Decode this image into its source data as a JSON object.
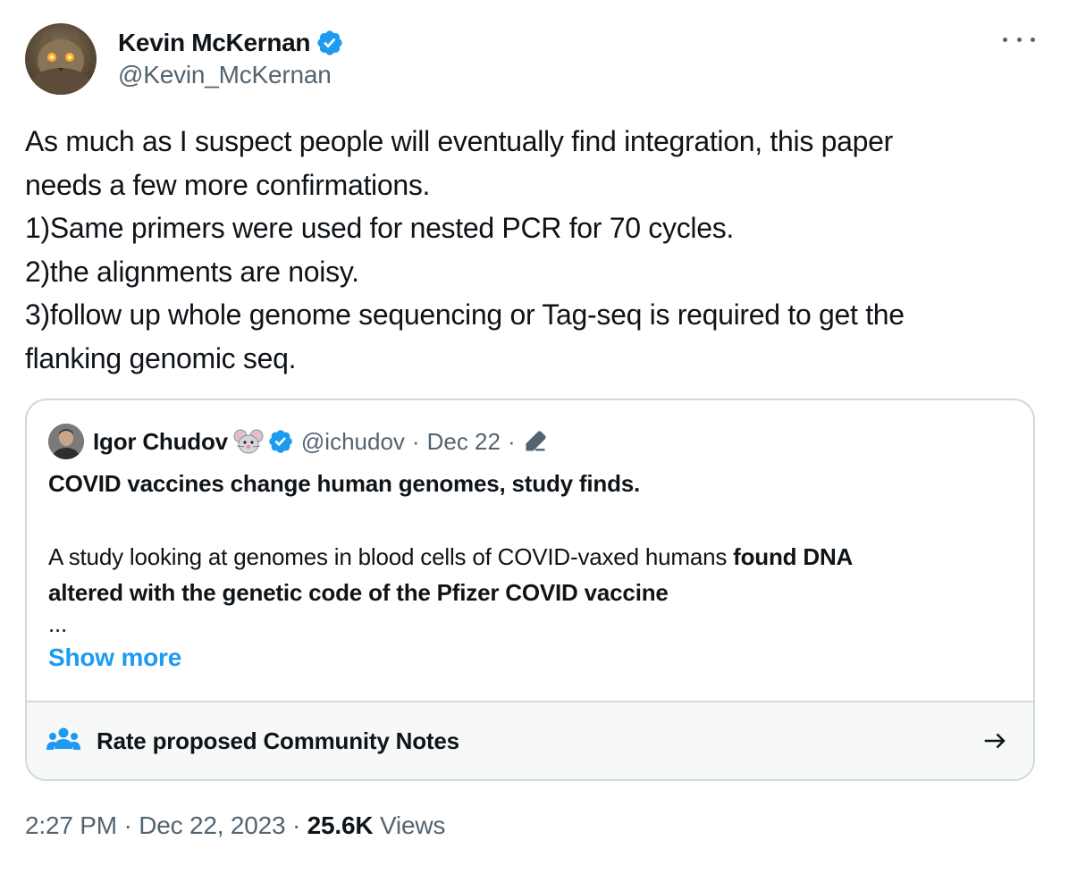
{
  "author": {
    "display_name": "Kevin McKernan",
    "handle": "@Kevin_McKernan",
    "verified": true,
    "avatar_icon": "cat-avatar"
  },
  "more_icon": "more-horizontal-icon",
  "tweet": {
    "lines": [
      "As much as I suspect people will eventually find integration, this paper",
      "needs a few more confirmations.",
      "1)Same primers were used for nested PCR for 70 cycles.",
      "2)the alignments are noisy.",
      "3)follow up whole genome sequencing or Tag-seq is required to get the",
      "flanking genomic seq."
    ]
  },
  "quote": {
    "display_name": "Igor Chudov",
    "emoji": "🐭",
    "handle": "@ichudov",
    "separator": "·",
    "date": "Dec 22",
    "edited_icon": "edit-pencil-icon",
    "title": "COVID vaccines change human genomes, study finds.",
    "body_line1_plain": "A study looking at genomes in blood cells of COVID-vaxed humans ",
    "body_line1_bold": "found DNA",
    "body_line2_bold": "altered with the genetic code of the Pfizer COVID vaccine",
    "ellipsis": "...",
    "show_more": "Show more"
  },
  "community_notes": {
    "label": "Rate proposed Community Notes",
    "icon": "people-icon",
    "arrow_icon": "arrow-right-icon"
  },
  "footer": {
    "time": "2:27 PM",
    "sep1": " · ",
    "date": "Dec 22, 2023",
    "sep2": " · ",
    "views_count": "25.6K",
    "views_label": " Views"
  },
  "colors": {
    "text": "#0f1419",
    "secondary": "#536471",
    "accent": "#1d9bf0",
    "border": "#cfd9de",
    "notes_bg": "#f7f9f9"
  }
}
